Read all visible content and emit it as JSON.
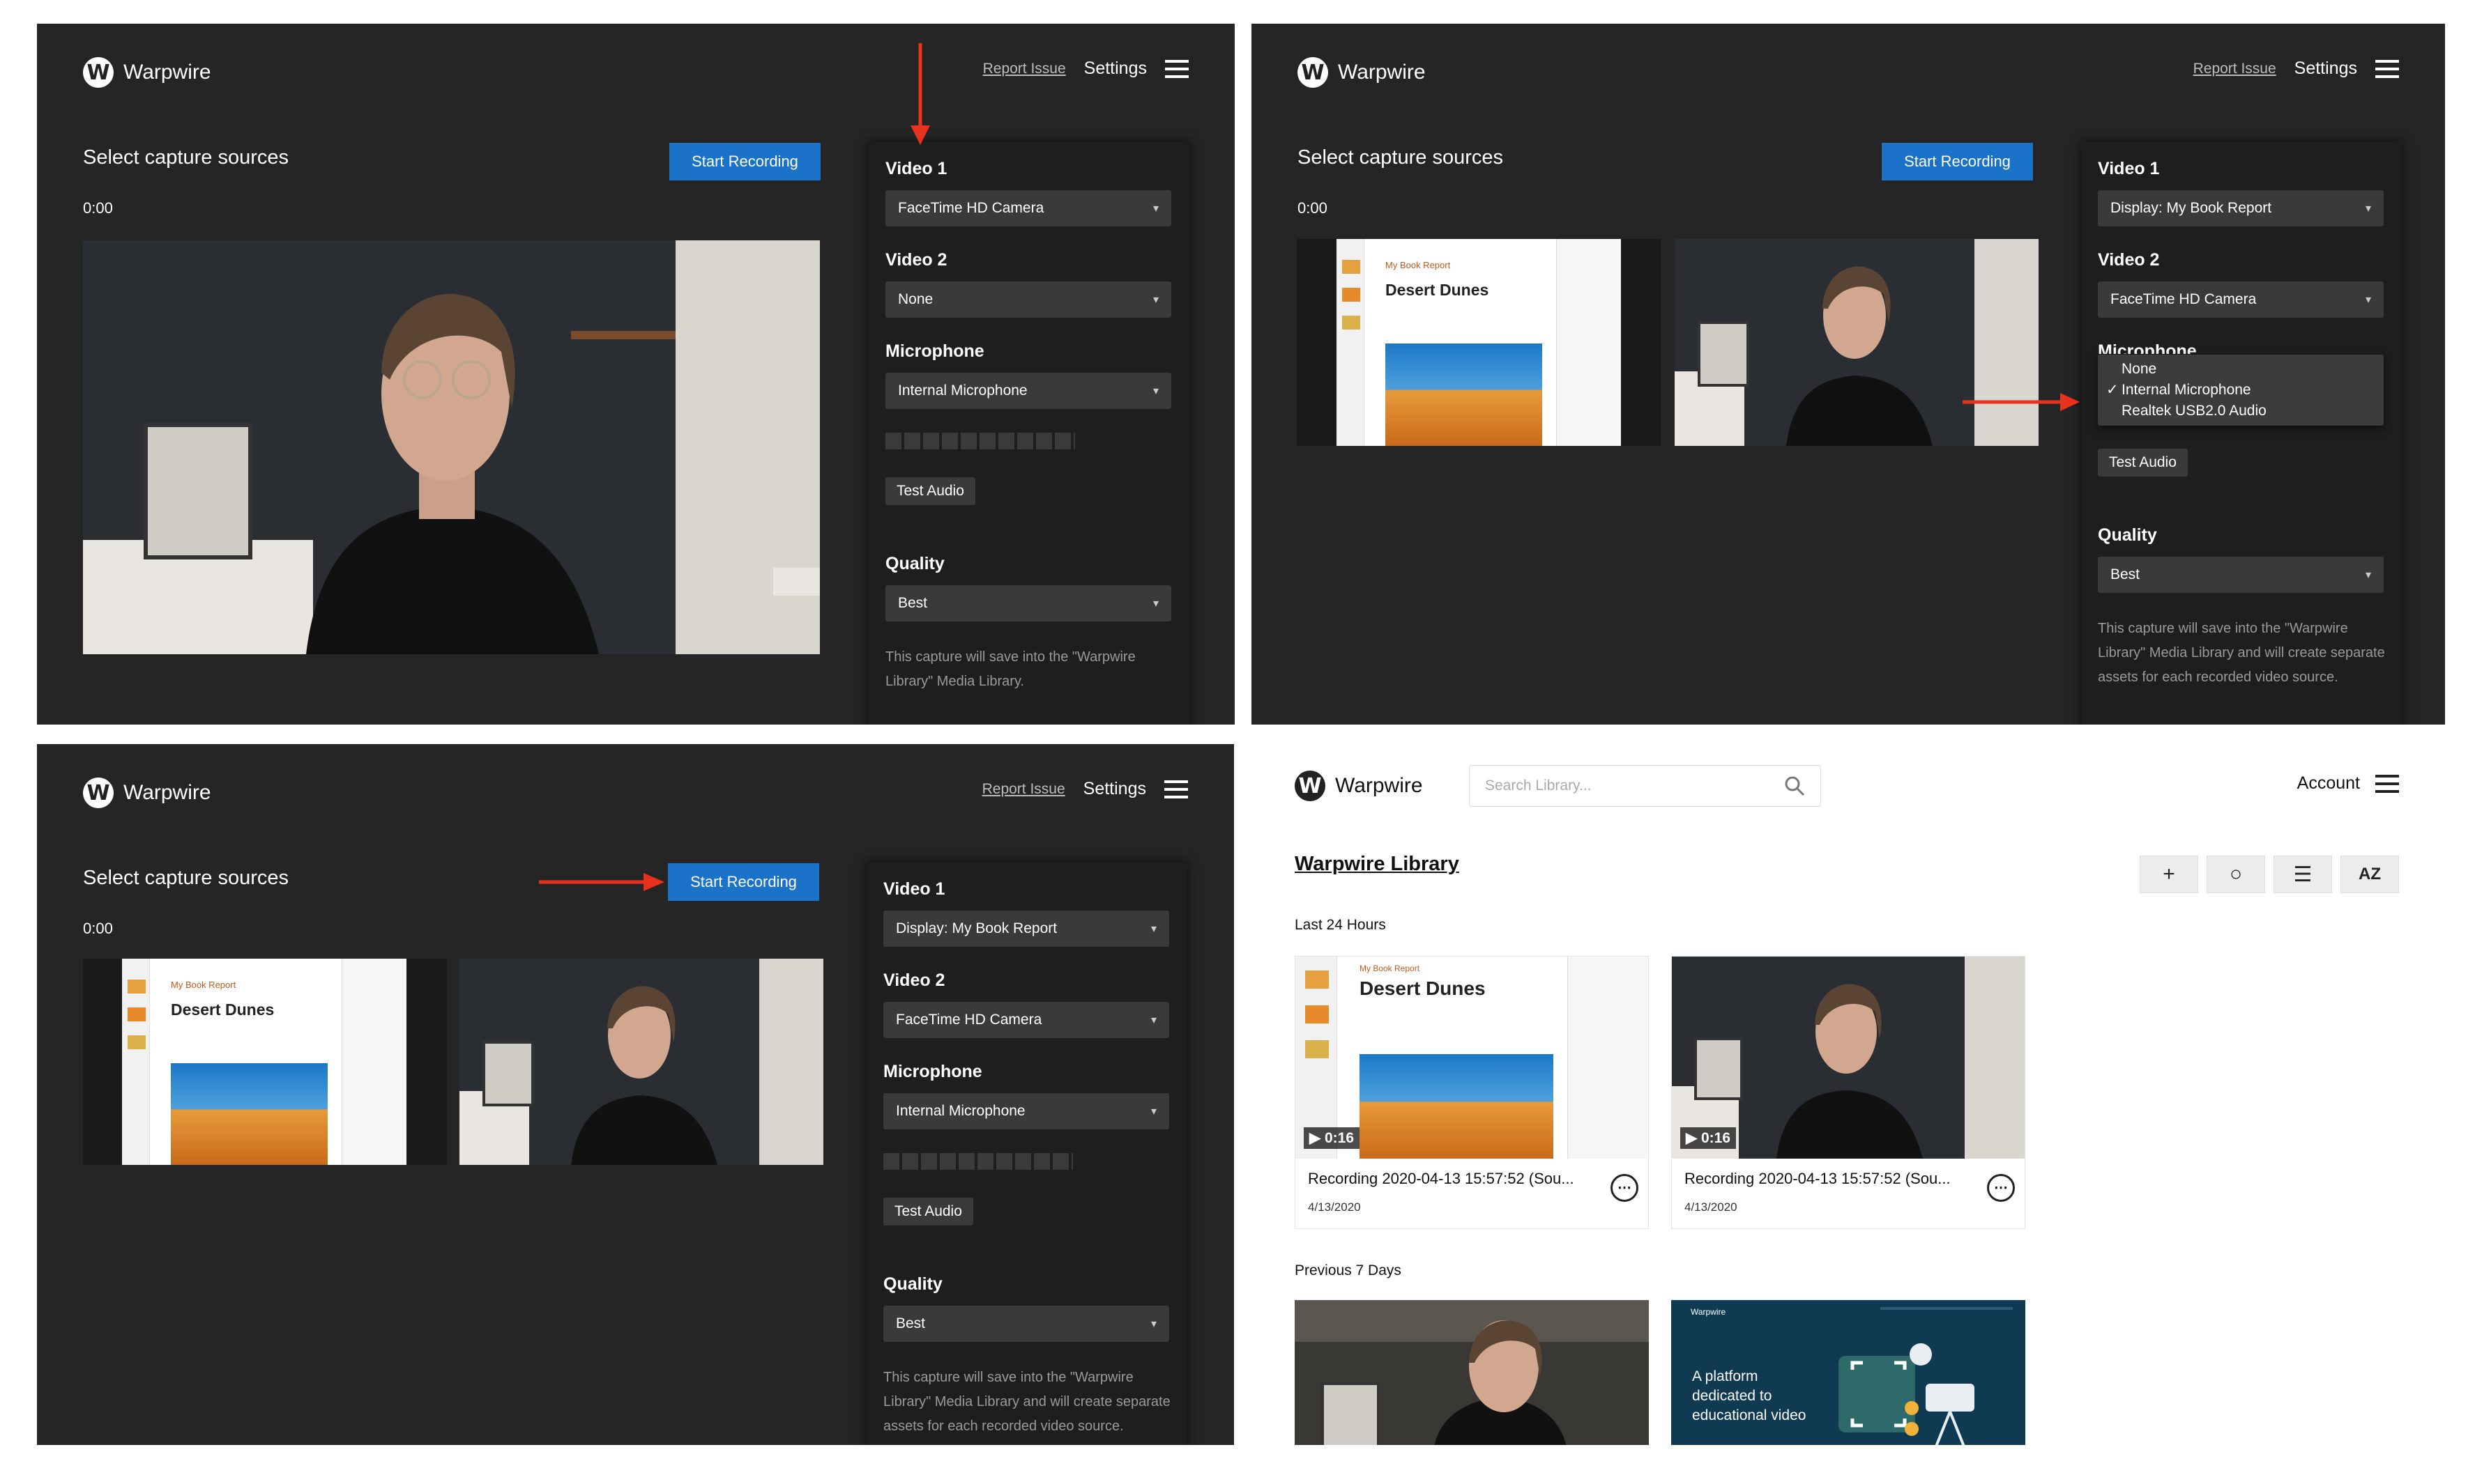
{
  "app": {
    "logo_letter": "W",
    "name": "Warpwire",
    "report_issue": "Report Issue",
    "settings": "Settings"
  },
  "capture": {
    "title": "Select capture sources",
    "timer": "0:00",
    "start_button": "Start Recording",
    "labels": {
      "video1": "Video 1",
      "video2": "Video 2",
      "microphone": "Microphone",
      "quality": "Quality",
      "test_audio": "Test Audio"
    },
    "panel1": {
      "video1": "FaceTime HD Camera",
      "video2": "None",
      "microphone": "Internal Microphone",
      "quality": "Best",
      "note": "This capture will save into the \"Warpwire Library\" Media Library."
    },
    "panel2": {
      "video1": "Display: My Book Report",
      "video2": "FaceTime HD Camera",
      "microphone_partial": "Microphone",
      "quality": "Best",
      "mic_options": [
        "None",
        "Internal Microphone",
        "Realtek USB2.0 Audio"
      ],
      "mic_selected_index": 1,
      "check": "✓",
      "note": "This capture will save into the \"Warpwire Library\" Media Library and will create separate assets for each recorded video source."
    },
    "panel3": {
      "video1": "Display: My Book Report",
      "video2": "FaceTime HD Camera",
      "microphone": "Internal Microphone",
      "quality": "Best",
      "note": "This capture will save into the \"Warpwire Library\" Media Library and will create separate assets for each recorded video source."
    },
    "slide_title": "Desert Dunes",
    "slide_kicker": "My Book Report"
  },
  "library": {
    "search_placeholder": "Search Library...",
    "account": "Account",
    "title": "Warpwire Library",
    "tools": [
      "+",
      "○",
      "☰",
      "AZ"
    ],
    "section_recent": "Last 24 Hours",
    "section_week": "Previous 7 Days",
    "cards": [
      {
        "duration": "▶ 0:16",
        "title": "Recording 2020-04-13 15:57:52 (Sou...",
        "date": "4/13/2020"
      },
      {
        "duration": "▶ 0:16",
        "title": "Recording 2020-04-13 15:57:52 (Sou...",
        "date": "4/13/2020"
      }
    ],
    "promo_text": "A platform dedicated to educational video",
    "promo_brand": "Warpwire"
  },
  "colors": {
    "accent": "#1a73c8",
    "arrow": "#e8321e",
    "dark_bg": "#252525"
  }
}
